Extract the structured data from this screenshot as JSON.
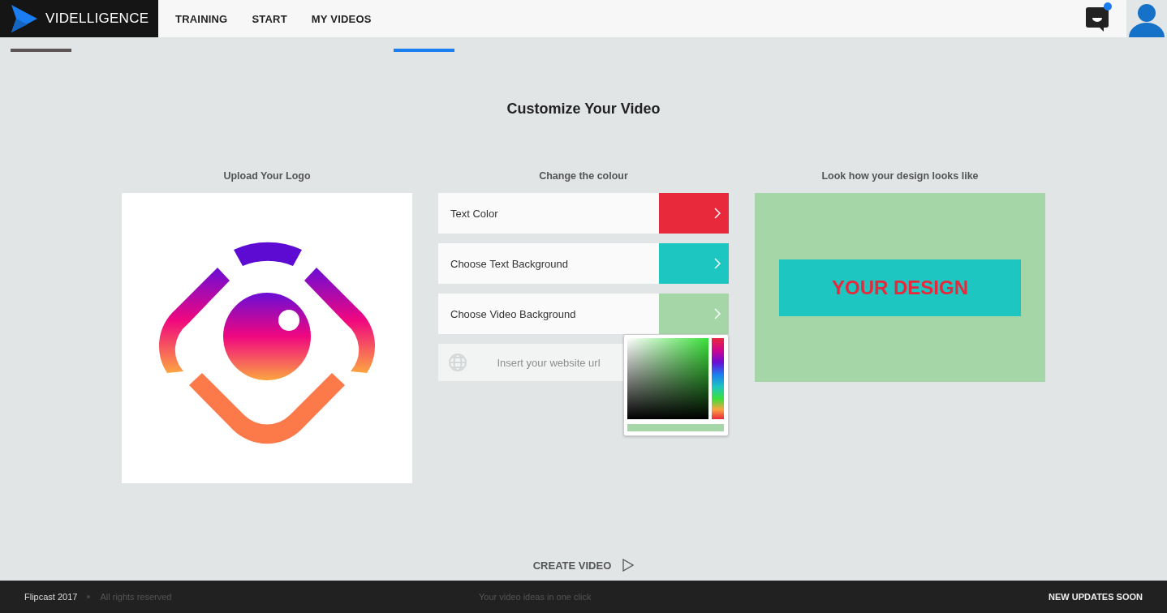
{
  "header": {
    "brand": "VIDELLIGENCE",
    "nav": [
      {
        "label": "TRAINING"
      },
      {
        "label": "START"
      },
      {
        "label": "MY VIDEOS"
      }
    ],
    "chat_unread": true
  },
  "steps": [
    {
      "selected": false
    },
    {
      "selected": true
    }
  ],
  "title": "Customize Your Video",
  "upload": {
    "heading": "Upload Your Logo"
  },
  "colours": {
    "heading": "Change the colour",
    "options": [
      {
        "label": "Text Color",
        "color": "#e8283b"
      },
      {
        "label": "Choose Text Background",
        "color": "#1dc6c1"
      },
      {
        "label": "Choose Video Background",
        "color": "#a5d6a7"
      }
    ],
    "url_field": {
      "placeholder": "Insert your website url"
    },
    "picker": {
      "open": true
    }
  },
  "preview": {
    "heading": "Look how your design looks like",
    "sample": "YOUR DESIGN"
  },
  "create_button": "CREATE VIDEO",
  "footer": {
    "copyright": "Flipcast 2017",
    "rights": "All rights reserved",
    "tagline": "Your video ideas in one click",
    "updates": "NEW UPDATES SOON"
  }
}
